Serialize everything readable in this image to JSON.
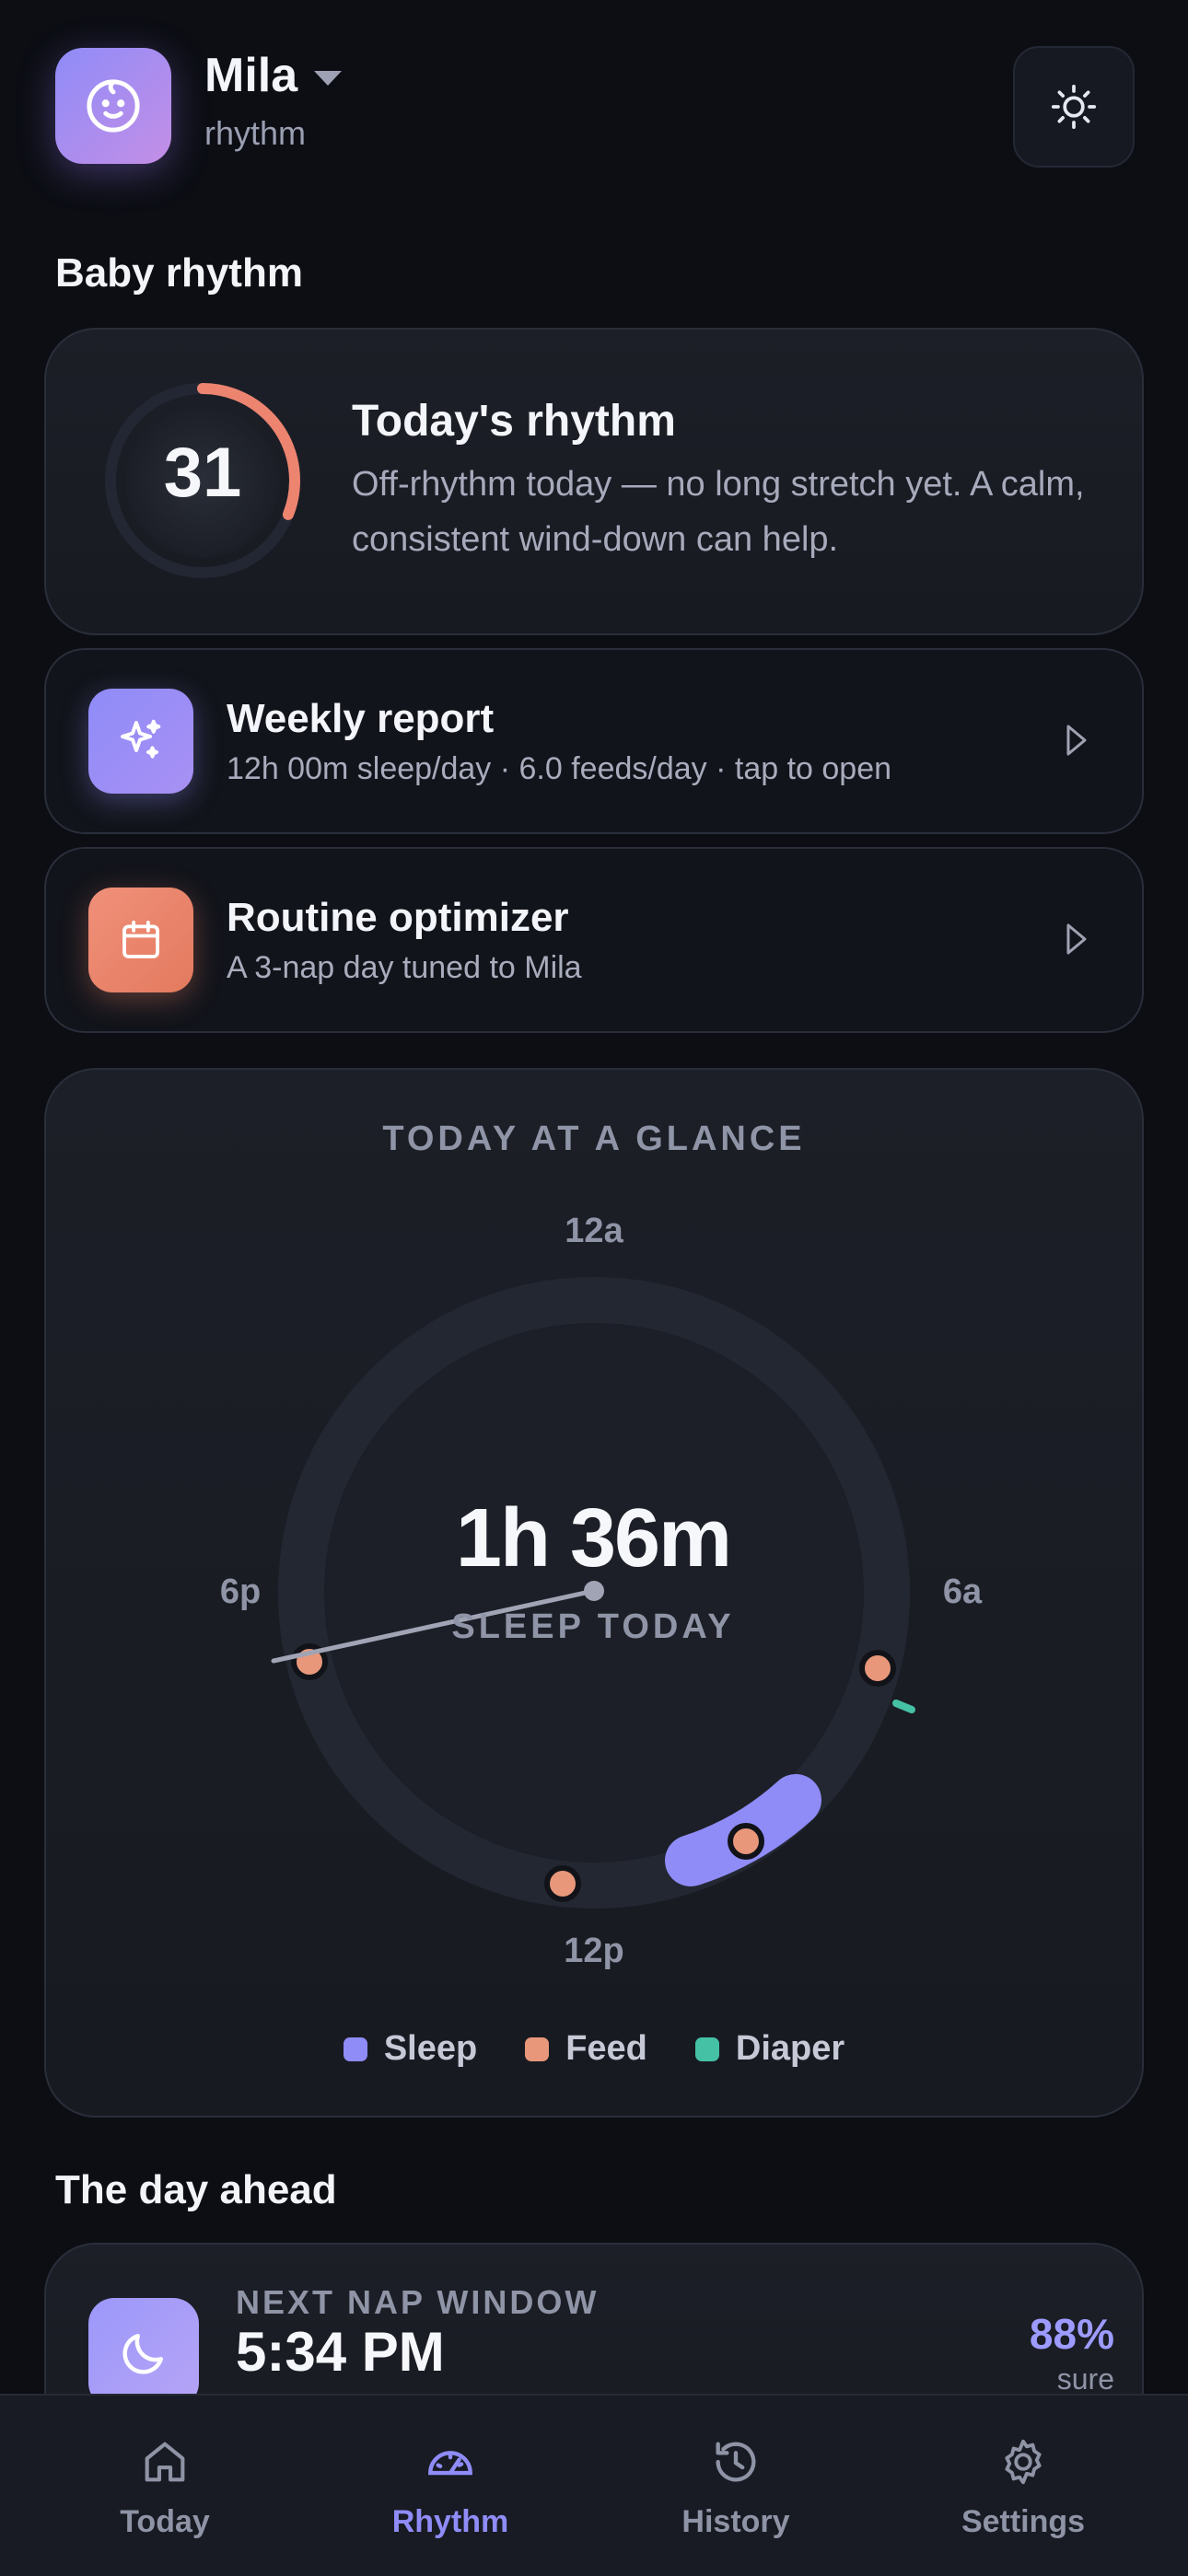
{
  "header": {
    "baby_name": "Mila",
    "subtitle": "rhythm",
    "avatar_icon": "baby-face-icon",
    "theme_icon": "sun-icon"
  },
  "sections": {
    "baby_rhythm": "Baby rhythm",
    "day_ahead": "The day ahead"
  },
  "rhythm_score": {
    "value": "31",
    "progress_fraction": 0.31,
    "title": "Today's rhythm",
    "description": "Off-rhythm today — no long stretch yet. A calm, consistent wind-down can help."
  },
  "weekly_report": {
    "title": "Weekly report",
    "subtitle": "12h 00m sleep/day · 6.0 feeds/day · tap to open",
    "icon": "sparkle-icon"
  },
  "routine_optimizer": {
    "title": "Routine optimizer",
    "subtitle": "A 3-nap day tuned to Mila",
    "icon": "calendar-icon"
  },
  "glance": {
    "title": "TODAY AT A GLANCE",
    "label_top": "12a",
    "label_right": "6a",
    "label_bottom": "12p",
    "label_left": "6p",
    "sleep_total": "1h 36m",
    "sleep_caption": "SLEEP TODAY",
    "legend": {
      "sleep": "Sleep",
      "feed": "Feed",
      "diaper": "Diaper"
    },
    "colors": {
      "sleep": "#8f8cf8",
      "feed": "#e8977a",
      "diaper": "#45c1a6"
    }
  },
  "next_nap": {
    "label": "NEXT NAP WINDOW",
    "time": "5:34 PM",
    "confidence": "88%",
    "confidence_caption": "sure",
    "icon": "moon-icon"
  },
  "nav": {
    "today": "Today",
    "rhythm": "Rhythm",
    "history": "History",
    "settings": "Settings",
    "active": "rhythm"
  }
}
